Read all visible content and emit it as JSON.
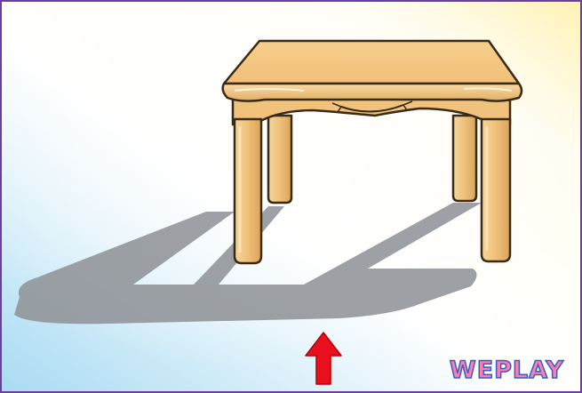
{
  "illustration": {
    "subject": "table-icon",
    "shadow": "shadow-icon",
    "arrow": "up-arrow-icon",
    "arrow_color": "#e8101c",
    "wood_color": "#f0c27b",
    "wood_outline": "#3a2a14",
    "shadow_color": "#8e9296",
    "background_start": "#cfe9f7",
    "background_end": "#fff6c8"
  },
  "watermark": {
    "text": "WEPLAY",
    "fill_color": "#ff7fa8",
    "outline_color": "#2f5fd0"
  },
  "frame": {
    "border_color": "#6b3fa0"
  }
}
